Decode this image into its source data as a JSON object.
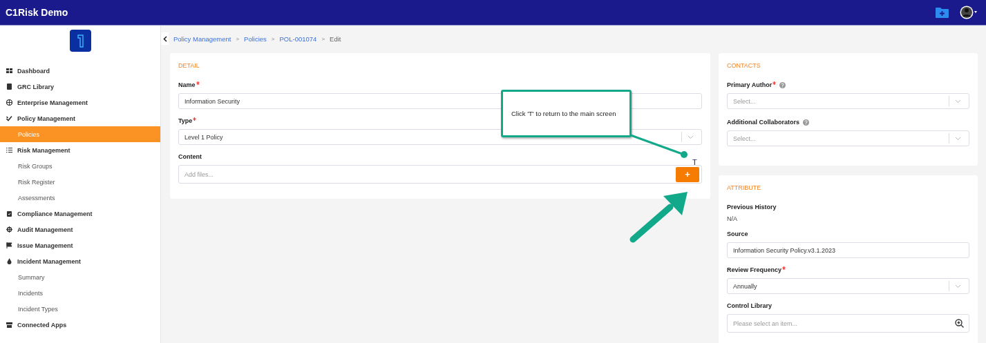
{
  "app": {
    "title": "C1Risk Demo"
  },
  "sidebar": {
    "items": [
      {
        "kind": "section",
        "label": "Dashboard",
        "selected": false
      },
      {
        "kind": "section",
        "label": "GRC Library",
        "selected": false
      },
      {
        "kind": "section",
        "label": "Enterprise Management",
        "selected": false
      },
      {
        "kind": "section",
        "label": "Policy Management",
        "selected": false
      },
      {
        "kind": "sub",
        "label": "Policies",
        "selected": true
      },
      {
        "kind": "section",
        "label": "Risk Management",
        "selected": false
      },
      {
        "kind": "sub",
        "label": "Risk Groups",
        "selected": false
      },
      {
        "kind": "sub",
        "label": "Risk Register",
        "selected": false
      },
      {
        "kind": "sub",
        "label": "Assessments",
        "selected": false
      },
      {
        "kind": "section",
        "label": "Compliance Management",
        "selected": false
      },
      {
        "kind": "section",
        "label": "Audit Management",
        "selected": false
      },
      {
        "kind": "section",
        "label": "Issue Management",
        "selected": false
      },
      {
        "kind": "section",
        "label": "Incident Management",
        "selected": false
      },
      {
        "kind": "sub",
        "label": "Summary",
        "selected": false
      },
      {
        "kind": "sub",
        "label": "Incidents",
        "selected": false
      },
      {
        "kind": "sub",
        "label": "Incident Types",
        "selected": false
      },
      {
        "kind": "section",
        "label": "Connected Apps",
        "selected": false
      }
    ]
  },
  "breadcrumb": [
    {
      "kind": "link",
      "label": "Policy Management"
    },
    {
      "kind": "link",
      "label": "Policies"
    },
    {
      "kind": "link",
      "label": "POL-001074"
    },
    {
      "kind": "current",
      "label": "Edit"
    }
  ],
  "breadcrumb_separator": ">",
  "detail": {
    "title": "DETAIL",
    "fields": [
      {
        "kind": "text",
        "label": "Name",
        "required": true,
        "value": "Information Security"
      },
      {
        "kind": "select",
        "label": "Type",
        "required": true,
        "value": "Level 1 Policy"
      },
      {
        "kind": "file",
        "label": "Content",
        "required": false,
        "placeholder": "Add files...",
        "button": "+"
      }
    ]
  },
  "contacts": {
    "title": "CONTACTS",
    "fields": [
      {
        "kind": "select",
        "label": "Primary Author",
        "required": true,
        "help": true,
        "placeholder": "Select..."
      },
      {
        "kind": "select",
        "label": "Additional Collaborators",
        "required": false,
        "help": true,
        "placeholder": "Select..."
      }
    ]
  },
  "attribute": {
    "title": "ATTRIBUTE",
    "fields": [
      {
        "kind": "static",
        "label": "Previous History",
        "required": false,
        "value": "N/A"
      },
      {
        "kind": "text",
        "label": "Source",
        "required": false,
        "value": "Information Security Policy.v3.1.2023"
      },
      {
        "kind": "select",
        "label": "Review Frequency",
        "required": true,
        "value": "Annually"
      },
      {
        "kind": "lookup",
        "label": "Control Library",
        "required": false,
        "placeholder": "Please select an item..."
      }
    ]
  },
  "callout": {
    "text": "Click 'T' to return to the main screen",
    "key": "T"
  }
}
